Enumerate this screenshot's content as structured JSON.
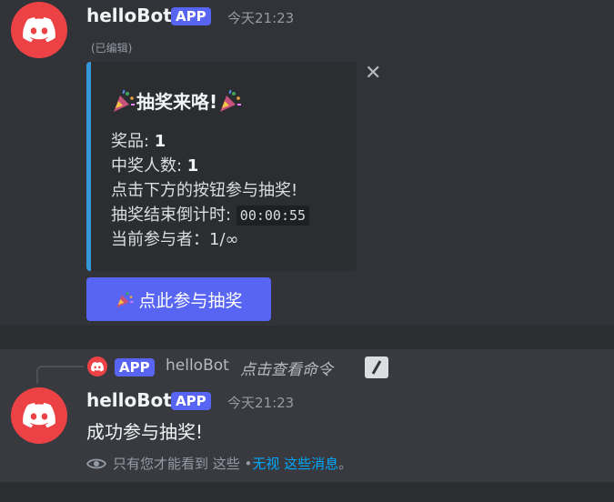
{
  "colors": {
    "background": "#313338",
    "highlight_background": "#383a40",
    "accent_blurple": "#5865f2",
    "embed_border": "#3498db",
    "avatar_red": "#ed4245",
    "link": "#00a8fc"
  },
  "message1": {
    "avatar_icon": "discord-logo-icon",
    "username": "helloBot",
    "badge": "APP",
    "timestamp": "今天21:23",
    "edited": "(已编辑)",
    "embed": {
      "close_icon": "close-icon",
      "title": "抽奖来咯!",
      "title_emoji": "party-popper-icon",
      "prize_label": "奖品: ",
      "prize_value": "1",
      "winners_label": "中奖人数: ",
      "winners_value": "1",
      "instruction": "点击下方的按钮参与抽奖!",
      "countdown_label": "抽奖结束倒计时: ",
      "countdown_value": "00:00:55",
      "participants": "当前参与者：1/∞"
    },
    "button": {
      "icon": "party-popper-icon",
      "label": "点此参与抽奖"
    }
  },
  "message2": {
    "reply": {
      "badge": "APP",
      "username": "helloBot",
      "command_text": "点击查看命令",
      "command_icon": "slash-command-icon"
    },
    "avatar_icon": "discord-logo-icon",
    "username": "helloBot",
    "badge": "APP",
    "timestamp": "今天21:23",
    "content": "成功参与抽奖!",
    "ephemeral": {
      "icon": "eye-icon",
      "text": "只有您才能看到 这些 • ",
      "dismiss_link": "无视 这些消息",
      "period": "。"
    }
  }
}
